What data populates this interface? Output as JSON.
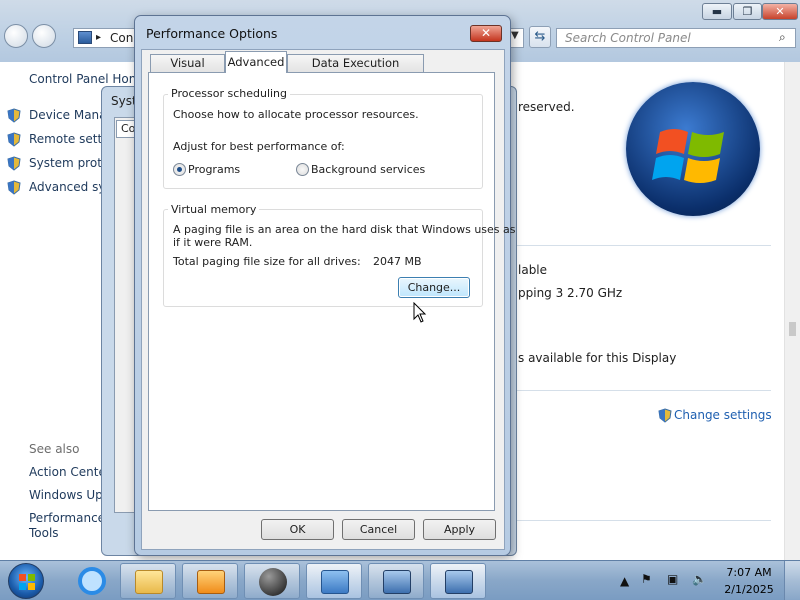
{
  "background_window": {
    "breadcrumb": "Con",
    "search_placeholder": "Search Control Panel",
    "caption_buttons": {
      "minimize": "▬",
      "maximize": "❐",
      "close": "✕"
    },
    "left_pane": {
      "home_link": "Control Panel Home",
      "links": [
        "Device Manag",
        "Remote settin",
        "System prote",
        "Advanced sys"
      ],
      "see_also_label": "See also",
      "see_also_links": [
        "Action Center",
        "Windows Upd",
        "Performance",
        "Tools"
      ]
    },
    "right_pane": {
      "reserved_text": "reserved.",
      "available_link": "lable",
      "processor_text": "pping 3  2.70 GHz",
      "display_text": "s available for this Display",
      "change_settings_link": "Change settings"
    }
  },
  "system_properties": {
    "title": "Syst",
    "tab_fragment": "Co"
  },
  "performance_dialog": {
    "title": "Performance Options",
    "close_label": "✕",
    "tabs": [
      "Visual Effects",
      "Advanced",
      "Data Execution Prevention"
    ],
    "active_tab": "Advanced",
    "processor_scheduling": {
      "group_label": "Processor scheduling",
      "description": "Choose how to allocate processor resources.",
      "adjust_label": "Adjust for best performance of:",
      "options": [
        {
          "label": "Programs",
          "selected": true
        },
        {
          "label": "Background services",
          "selected": false
        }
      ]
    },
    "virtual_memory": {
      "group_label": "Virtual memory",
      "description_line1": "A paging file is an area on the hard disk that Windows uses as",
      "description_line2": "if it were RAM.",
      "total_label": "Total paging file size for all drives:",
      "total_value": "2047 MB",
      "change_button": "Change..."
    },
    "buttons": {
      "ok": "OK",
      "cancel": "Cancel",
      "apply": "Apply"
    }
  },
  "taskbar": {
    "time": "7:07 AM",
    "date": "2/1/2025",
    "items": [
      "ie-icon",
      "explorer-icon",
      "media-player-icon",
      "ball-icon",
      "control-panel-icon",
      "remote-desktop-icon",
      "system-icon"
    ]
  }
}
